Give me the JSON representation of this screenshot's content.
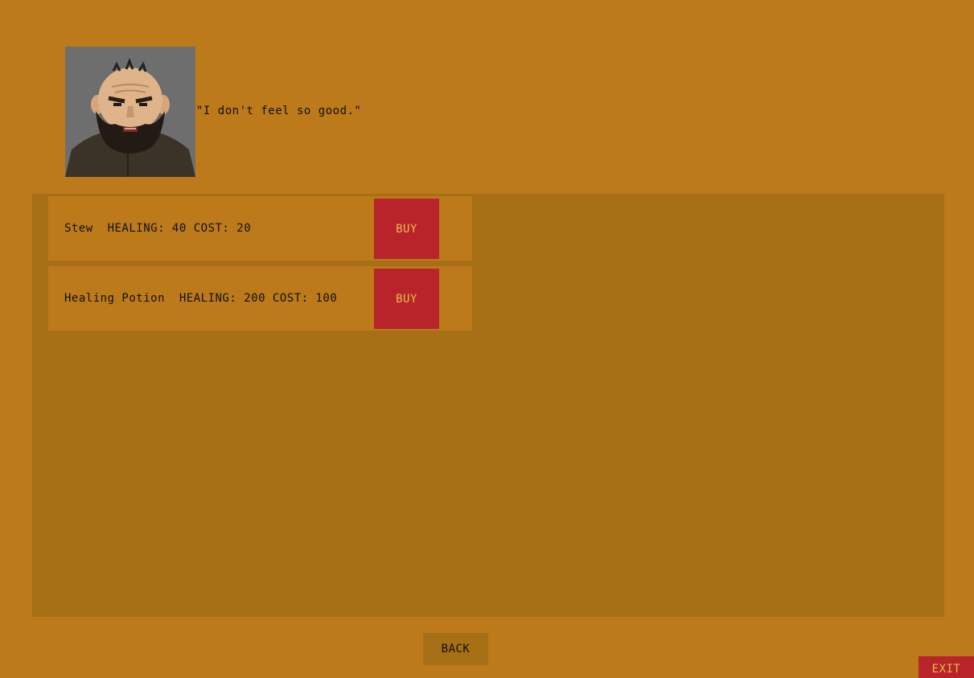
{
  "npc": {
    "portrait_icon": "bearded-merchant-portrait",
    "dialogue": "\"I don't feel so good.\""
  },
  "shop": {
    "items": [
      {
        "label": "Stew  HEALING: 40 COST: 20",
        "buy_label": "BUY"
      },
      {
        "label": "Healing Potion  HEALING: 200 COST: 100",
        "buy_label": "BUY"
      }
    ]
  },
  "nav": {
    "back_label": "BACK",
    "exit_label": "EXIT"
  },
  "colors": {
    "background": "#bc7a1a",
    "panel": "#a76f16",
    "button_red": "#b8242a",
    "button_text": "#e8b94a"
  }
}
